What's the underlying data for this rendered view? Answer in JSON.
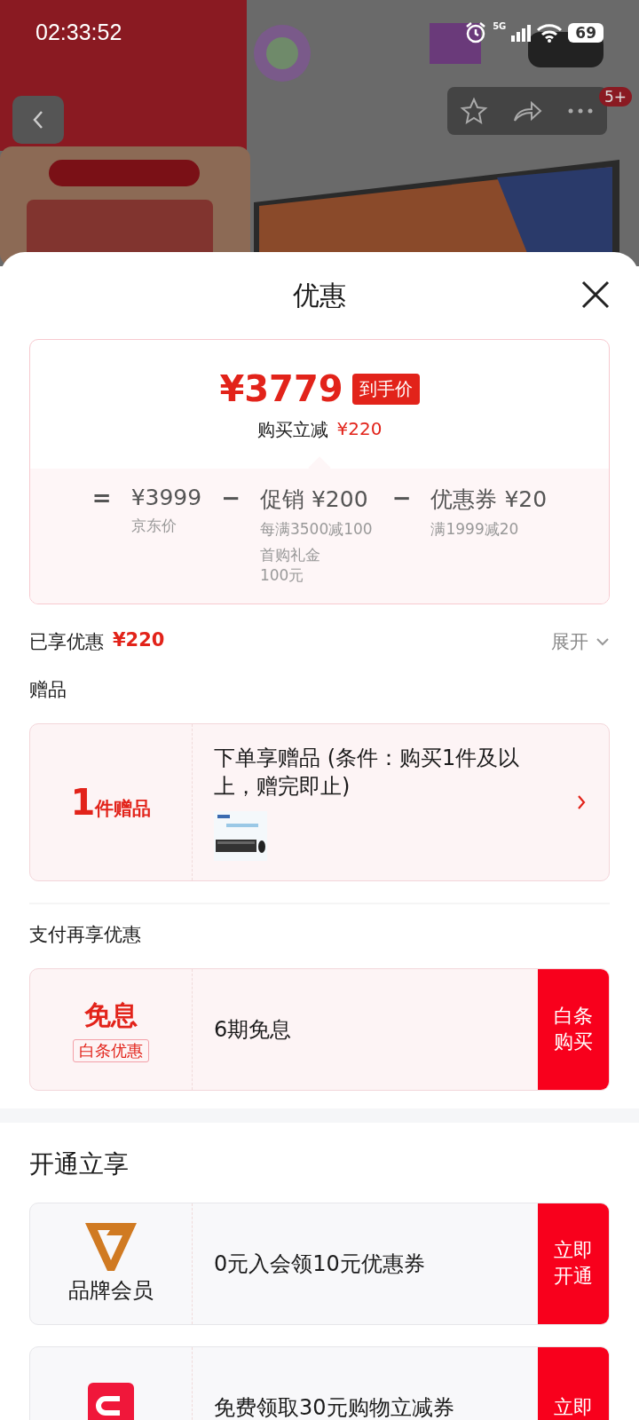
{
  "status_bar": {
    "time": "02:33:52",
    "battery": "69",
    "network": "5G"
  },
  "top_nav": {
    "badge": "5+"
  },
  "sheet": {
    "title": "优惠",
    "summary": {
      "price": "¥3779",
      "price_tag": "到手价",
      "saving_label": "购买立减",
      "saving": "¥220",
      "terms": [
        {
          "op": "=",
          "amount": "¥3999",
          "notes": [
            "京东价"
          ]
        },
        {
          "op": "−",
          "amount": "促销 ¥200",
          "notes": [
            "每满3500减100",
            "首购礼金\n100元"
          ]
        },
        {
          "op": "−",
          "amount": "优惠券 ¥20",
          "notes": [
            "满1999减20"
          ]
        }
      ]
    },
    "enjoyed": {
      "label": "已享优惠",
      "amount": "¥220",
      "toggle": "展开"
    },
    "sections": [
      {
        "title": "赠品",
        "cards": [
          {
            "kind": "gift",
            "count": "1",
            "count_unit": "件赠品",
            "text": "下单享赠品 (条件：购买1件及以上，赠完即止)"
          }
        ]
      },
      {
        "title": "支付再享优惠",
        "cards": [
          {
            "kind": "pay",
            "head": "免息",
            "tag": "白条优惠",
            "text": "6期免息",
            "action": "白条购买"
          }
        ]
      }
    ],
    "open_title": "开通立享",
    "open_cards": [
      {
        "kind": "brand",
        "head": "品牌会员",
        "text": "0元入会领10元优惠券",
        "action": "立即开通"
      },
      {
        "kind": "red",
        "text": "免费领取30元购物立减券",
        "action": "立即"
      }
    ]
  }
}
